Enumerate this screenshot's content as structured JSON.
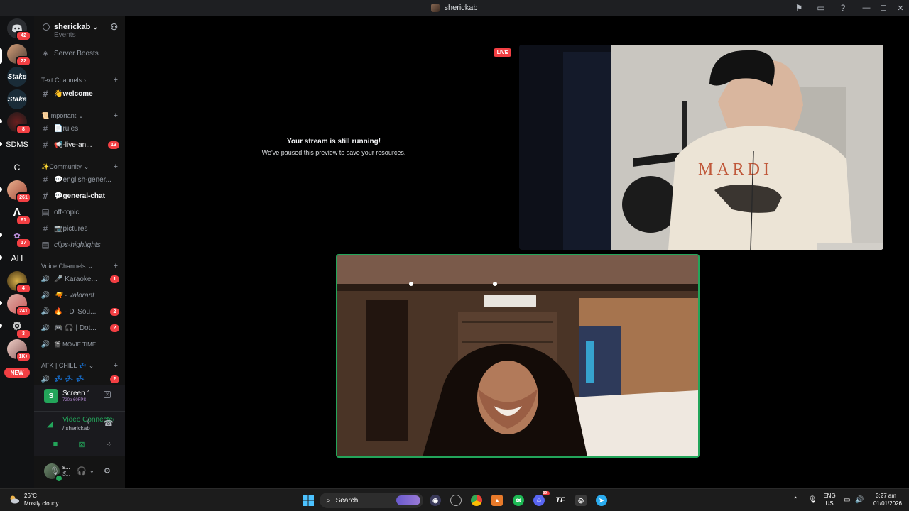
{
  "window": {
    "title": "sherickab"
  },
  "rail": {
    "servers": [
      {
        "name": "direct-messages",
        "badge": "42"
      },
      {
        "name": "server-1",
        "badge": "22"
      },
      {
        "name": "stake-1",
        "label": "Stake"
      },
      {
        "name": "stake-2",
        "label": "Stake"
      },
      {
        "name": "server-5",
        "badge": "8"
      },
      {
        "name": "sdms",
        "label": "SDMS"
      },
      {
        "name": "c-server",
        "label": "C"
      },
      {
        "name": "server-8",
        "badge": "261"
      },
      {
        "name": "server-9",
        "badge": "61"
      },
      {
        "name": "server-10",
        "badge": "17"
      },
      {
        "name": "ah-server",
        "label": "AH"
      },
      {
        "name": "server-12",
        "badge": "4"
      },
      {
        "name": "server-13",
        "badge": "241"
      },
      {
        "name": "server-14",
        "badge": "3"
      },
      {
        "name": "server-15",
        "badge": "1K+"
      }
    ],
    "new_label": "NEW"
  },
  "sidebar": {
    "server_name": "sherickab",
    "events_label": "Events",
    "boosts_label": "Server Boosts",
    "cat_text": "Text Channels",
    "welcome": "👋welcome",
    "cat_important": "📜Important",
    "rules": "📄rules",
    "live_an": "📢-live-an...",
    "live_an_badge": "13",
    "cat_community": "✨Community",
    "english": "💬english-gener...",
    "general": "💬general-chat",
    "offtopic": "off-topic",
    "pictures": "📷pictures",
    "clips": "clips-highlights",
    "cat_voice": "Voice Channels",
    "karaoke": "🎤 Karaoke...",
    "karaoke_badge": "1",
    "valorant": "🔫 · valorant",
    "dsou": "🔥 · D' Sou...",
    "dsou_badge": "2",
    "dot": "🎮 🎧 | Dot...",
    "dot_badge": "2",
    "movie": "🎬 MOVIE TIME",
    "cat_afk": "AFK | CHILL 💤",
    "afk": "💤 💤 💤",
    "afk_badge": "2"
  },
  "screen": {
    "title": "Screen 1",
    "sub": "720p 60FPS",
    "icon": "S"
  },
  "voice": {
    "status": "Video Connected",
    "sub": "/ sherickab"
  },
  "user": {
    "name": "s...",
    "status": "S..."
  },
  "stage": {
    "paused_title": "Your stream is still running!",
    "paused_sub": "We've paused this preview to save your resources.",
    "live": "LIVE",
    "shirt_text": "MARDI"
  },
  "taskbar": {
    "temp": "26°C",
    "weather": "Mostly cloudy",
    "search": "Search",
    "lang": "ENG",
    "region": "US",
    "time": "3:27 am",
    "date": "01/01/2026",
    "discord_badge": "99+"
  },
  "colors": {
    "accent_green": "#23a55a",
    "badge_red": "#f23f43",
    "bg_dark": "#111214"
  }
}
